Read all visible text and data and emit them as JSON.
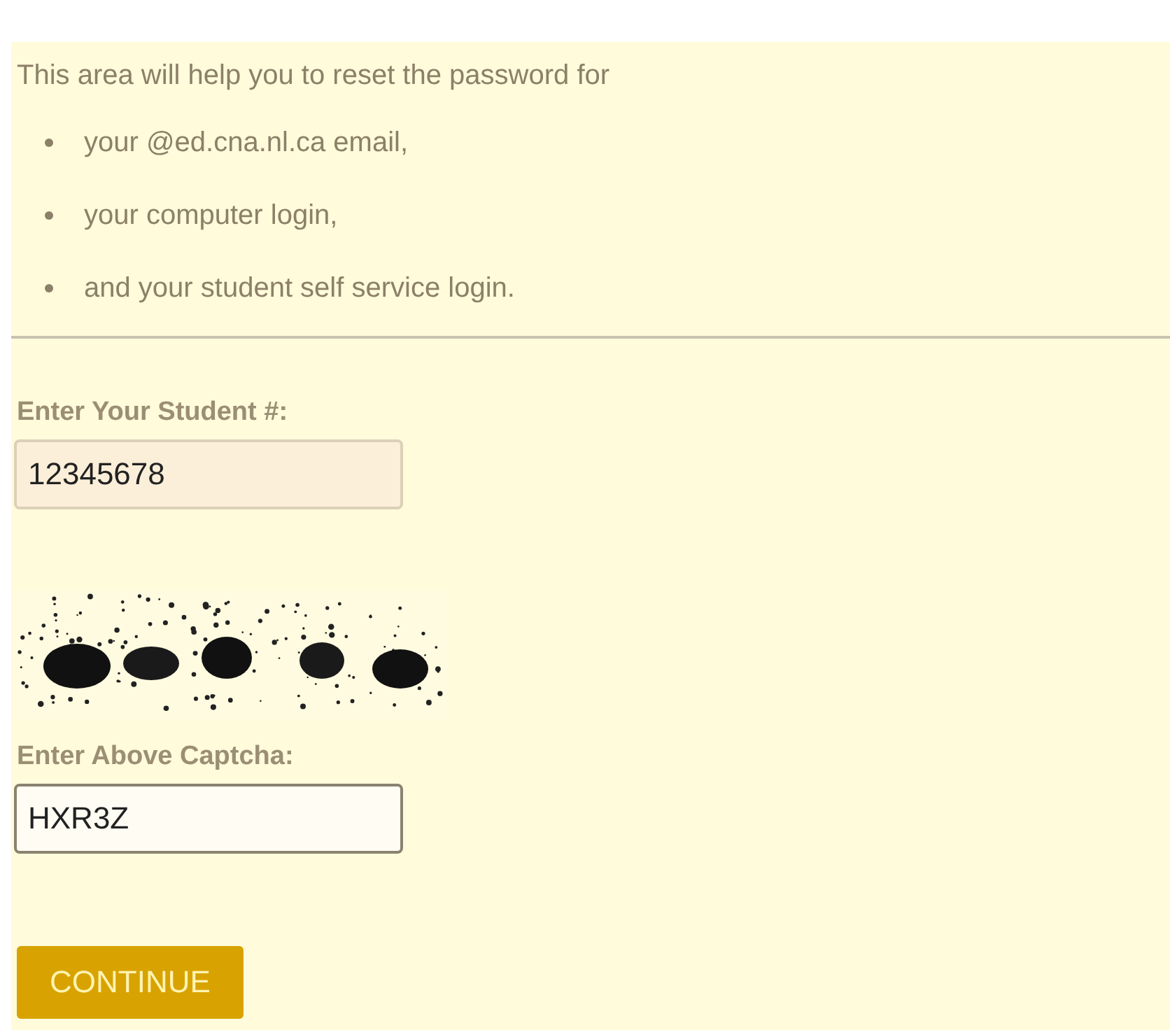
{
  "intro": "This area will help you to reset the password for",
  "bullets": [
    "your @ed.cna.nl.ca email,",
    "your computer login,",
    "and your student self service login."
  ],
  "fields": [
    {
      "kind": "text",
      "label": "Enter Your Student #:",
      "value": "12345678"
    },
    {
      "kind": "captcha",
      "label": "Enter Above Captcha:",
      "value": "HXR3Z"
    }
  ],
  "button": "CONTINUE"
}
